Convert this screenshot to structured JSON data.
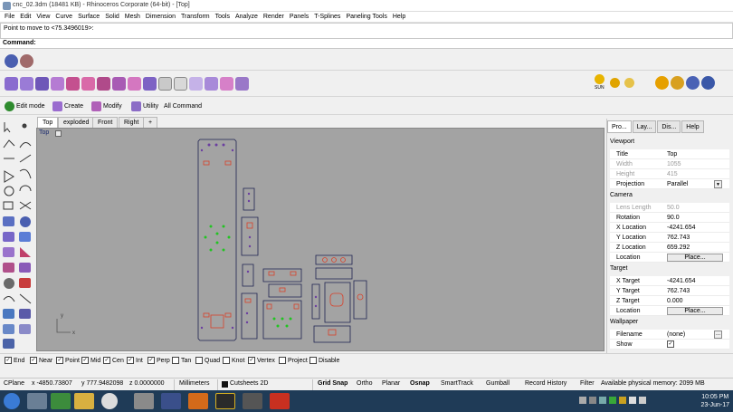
{
  "window": {
    "title": "cnc_02.3dm (18481 KB) - Rhinoceros Corporate (64-bit) - [Top]"
  },
  "menu": [
    "File",
    "Edit",
    "View",
    "Curve",
    "Surface",
    "Solid",
    "Mesh",
    "Dimension",
    "Transform",
    "Tools",
    "Analyze",
    "Render",
    "Panels",
    "T-Splines",
    "Paneling Tools",
    "Help"
  ],
  "command": {
    "history": "Point to move to <75.3496019>:",
    "prompt": "Command:"
  },
  "toolbar": {
    "edit_mode": "Edit mode",
    "create": "Create",
    "modify": "Modify",
    "utility": "Utility",
    "all_command": "All Command",
    "sun_label": "SUN"
  },
  "viewport_tabs": [
    "Top",
    "exploded",
    "Front",
    "Right",
    "+"
  ],
  "viewport": {
    "label": "Top",
    "drop": "▾",
    "axis_x": "x",
    "axis_y": "y"
  },
  "panel": {
    "tabs": [
      "Pro...",
      "Lay...",
      "Dis...",
      "Help"
    ],
    "viewport_header": "Viewport",
    "title_k": "Title",
    "title_v": "Top",
    "width_k": "Width",
    "width_v": "1055",
    "height_k": "Height",
    "height_v": "415",
    "projection_k": "Projection",
    "projection_v": "Parallel",
    "camera_header": "Camera",
    "lens_k": "Lens Length",
    "lens_v": "50.0",
    "rotation_k": "Rotation",
    "rotation_v": "90.0",
    "xloc_k": "X Location",
    "xloc_v": "-4241.654",
    "yloc_k": "Y Location",
    "yloc_v": "762.743",
    "zloc_k": "Z Location",
    "zloc_v": "659.292",
    "loc_k": "Location",
    "place": "Place...",
    "target_header": "Target",
    "xt_k": "X Target",
    "xt_v": "-4241.654",
    "yt_k": "Y Target",
    "yt_v": "762.743",
    "zt_k": "Z Target",
    "zt_v": "0.000",
    "tloc_k": "Location",
    "wallpaper_header": "Wallpaper",
    "filename_k": "Filename",
    "filename_v": "(none)",
    "show_k": "Show",
    "dots": "..."
  },
  "osnap": [
    {
      "label": "End",
      "checked": true
    },
    {
      "label": "Near",
      "checked": true
    },
    {
      "label": "Point",
      "checked": true
    },
    {
      "label": "Mid",
      "checked": true
    },
    {
      "label": "Cen",
      "checked": true
    },
    {
      "label": "Int",
      "checked": true
    },
    {
      "label": "Perp",
      "checked": true
    },
    {
      "label": "Tan",
      "checked": false
    },
    {
      "label": "Quad",
      "checked": false
    },
    {
      "label": "Knot",
      "checked": false
    },
    {
      "label": "Vertex",
      "checked": true
    },
    {
      "label": "Project",
      "checked": false
    },
    {
      "label": "Disable",
      "checked": false
    }
  ],
  "status": {
    "cplane": "CPlane",
    "x": "x -4850.73807",
    "y": "y 777.9482098",
    "z": "z 0.0000000",
    "units": "Millimeters",
    "layer": "Cutsheets 2D",
    "grid_snap": "Grid Snap",
    "ortho": "Ortho",
    "planar": "Planar",
    "osnap": "Osnap",
    "smarttrack": "SmartTrack",
    "gumball": "Gumball",
    "record_history": "Record History",
    "filter": "Filter",
    "memory": "Available physical memory: 2099 MB"
  },
  "clock": {
    "time": "10:05 PM",
    "date": "23-Jun-17"
  },
  "colors": {
    "viewport_bg": "#a3a3a3",
    "part_outline": "#1e2250",
    "hole_red": "#d8402a",
    "hole_purple": "#6b3fa0",
    "dot_green": "#22c422",
    "taskbar": "#1f3b57"
  }
}
